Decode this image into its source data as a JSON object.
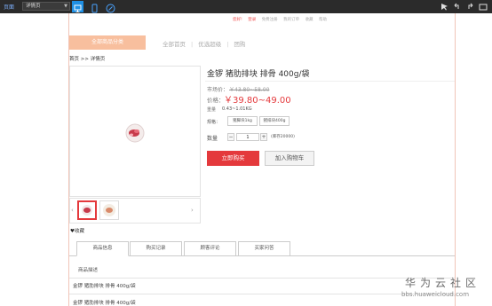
{
  "editor_toolbar": {
    "left_label": "页面",
    "page_select": "详情页",
    "buttons": [
      "desktop-view",
      "mobile-view",
      "link"
    ],
    "right_icons": [
      "arrow-icon",
      "undo-icon",
      "redo-icon",
      "fullscreen-icon"
    ]
  },
  "site": {
    "top_nav": [
      "您好!",
      "登录",
      "免费注册",
      "我的订单",
      "收藏",
      "帮助"
    ],
    "category_button": "全部商品分类",
    "nav_links": [
      "全部首页",
      "优选超级",
      "团购"
    ],
    "breadcrumb": {
      "home": "首页",
      "sep": ">>",
      "current": "详情页"
    }
  },
  "product": {
    "title": "金锣 猪肋排块 排骨 400g/袋",
    "market_price_label": "市场价：",
    "market_price": "￥43.80~58.00",
    "price_label": "价格：",
    "price": "￥39.80~49.00",
    "weight_label": "重量",
    "weight": "0.43~1.01KG",
    "spec_label": "规格：",
    "spec_options": [
      "猪脚块1kg",
      "猪排块400g"
    ],
    "quantity_label": "数量",
    "quantity": "1",
    "stock": "(库存20000)",
    "buy_now": "立即购买",
    "add_to_cart": "加入购物车",
    "favorite": "收藏"
  },
  "tabs": [
    "商品信息",
    "购买记录",
    "顾客评论",
    "买家问答"
  ],
  "description": {
    "heading": "商品描述",
    "lines": [
      "金锣 猪肋排块 排骨 400g/袋",
      "金锣 猪肋排块 排骨 400g/袋"
    ]
  },
  "watermark": {
    "text": "华为云社区",
    "url": "bbs.huaweicloud.com"
  },
  "colors": {
    "accent": "#e4393c",
    "toolbar": "#2b2b2b",
    "category": "#f8bf9e",
    "toolbar_active": "#1f8fe3"
  }
}
